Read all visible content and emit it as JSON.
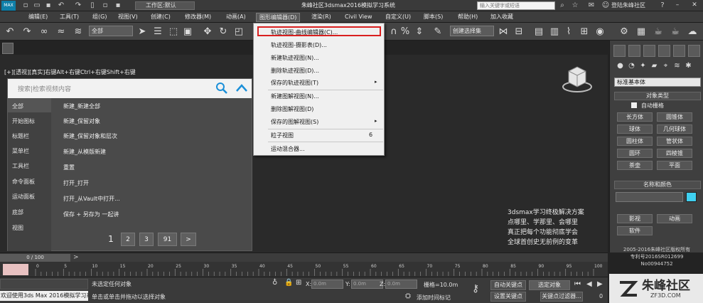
{
  "titlebar": {
    "workspace": "工作区:默认",
    "title": "朱峰社区3dsmax2016模拟学习系统",
    "search_placeholder": "输入关键字或短语",
    "login": "登陆朱峰社区",
    "logo_text": "MAX"
  },
  "menubar": {
    "items": [
      "编辑(E)",
      "工具(T)",
      "组(G)",
      "视图(V)",
      "创建(C)",
      "修改器(M)",
      "动画(A)",
      "图形编辑器(D)",
      "渲染(R)",
      "Civil View",
      "自定义(U)",
      "脚本(S)",
      "帮助(H)",
      "加入收藏"
    ],
    "open_item": "图形编辑器(D)"
  },
  "toolbar": {
    "filter_select": "全部",
    "selection_set": "创建选择集"
  },
  "dropdown": {
    "items": [
      {
        "label": "轨迹视图-曲线编辑器(C)...",
        "arrow": "",
        "highlighted": true
      },
      {
        "label": "轨迹视图-摄影表(D)...",
        "arrow": ""
      },
      {
        "label": "新建轨迹视图(N)...",
        "arrow": ""
      },
      {
        "label": "删除轨迹视图(D)...",
        "arrow": ""
      },
      {
        "label": "保存的轨迹视图(T)",
        "arrow": "▸"
      },
      {
        "label": "新建图解视图(N)...",
        "arrow": ""
      },
      {
        "label": "删除图解视图(D)",
        "arrow": ""
      },
      {
        "label": "保存的图解视图(S)",
        "arrow": "▸"
      },
      {
        "label": "粒子视图",
        "arrow": ""
      },
      {
        "label": "运动混合器...",
        "arrow": ""
      }
    ],
    "particle_shortcut": "6"
  },
  "viewport": {
    "label": "[+][透视][真实]右键Alt+右键Ctrl+右键Shift+右键",
    "promo": [
      "3dsmax学习终极解决方案",
      "点哪里、学那里、会哪里",
      "真正把每个功能彻底学会",
      "全球首创史无前例的变革"
    ]
  },
  "search_panel": {
    "placeholder": "搜索|检索视频内容",
    "categories": [
      "全部",
      "开始图标",
      "标题栏",
      "菜单栏",
      "工具栏",
      "命令面板",
      "运动面板",
      "底部",
      "视图"
    ],
    "rows": [
      "新建_新建全部",
      "新建_保留对象",
      "新建_保留对象和层次",
      "新建_从模版新建",
      "重置",
      "打开_打开",
      "打开_从Vault中打开...",
      "保存 + 另存为 一起讲"
    ],
    "pages": [
      "1",
      "2",
      "3",
      "91",
      ">"
    ]
  },
  "command_panel": {
    "category_select": "标准基本体",
    "object_type_title": "对象类型",
    "autogrid": "自动栅格",
    "objects": [
      "长方体",
      "圆锥体",
      "球体",
      "几何球体",
      "圆柱体",
      "管状体",
      "圆环",
      "四棱锥",
      "茶壶",
      "平面"
    ],
    "name_color_title": "名称和颜色",
    "bottom_buttons": [
      "影视",
      "动画",
      "软件"
    ],
    "name_color_hex": "#3fd0f0",
    "copyright": [
      "2005-2016朱峰社区版权所有",
      "专利号2016SR012699",
      "No00944752"
    ]
  },
  "timeline": {
    "slider": "0 / 100",
    "next": ">",
    "ticks": [
      "0",
      "5",
      "10",
      "15",
      "20",
      "25",
      "30",
      "35",
      "40",
      "45",
      "50",
      "55",
      "60",
      "65",
      "70",
      "75",
      "80",
      "85",
      "90",
      "95",
      "100"
    ]
  },
  "statusbar": {
    "welcome": "欢迎使用3ds Max 2016模拟学习系统",
    "status1": "未选定任何对象",
    "status2": "单击或单击并拖动以选择对象",
    "x_label": "X:",
    "x_val": "0.0m",
    "y_label": "Y:",
    "y_val": "0.0m",
    "z_label": "Z:",
    "z_val": "0.0m",
    "grid": "栅格=10.0m",
    "add_time_tag": "添加时间标记",
    "auto_key": "自动关键点",
    "set_key": "设置关键点",
    "key_filter_select": "选定对象",
    "key_filter": "关键点过滤器...",
    "frame": "0"
  },
  "brand": {
    "name": "朱峰社区",
    "url": "ZF3D.COM"
  },
  "colors": {
    "accent": "#0f7fa8",
    "highlight_border": "#d91f1f",
    "trackbar_key": "#e8c1c1"
  }
}
